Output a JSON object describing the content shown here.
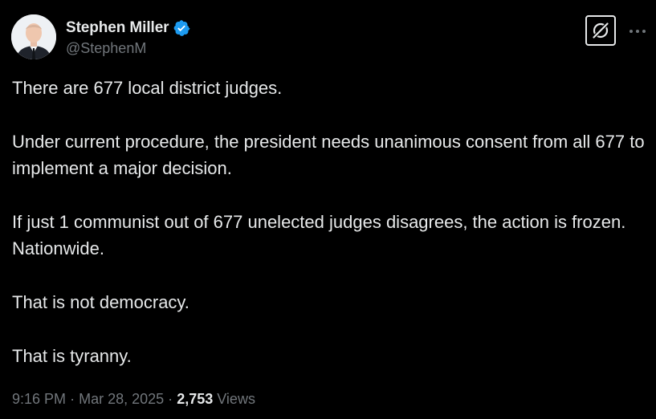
{
  "author": {
    "display_name": "Stephen Miller",
    "handle": "@StephenM",
    "verified": true,
    "verified_color": "#1d9bf0",
    "avatar_icon": "profile-photo"
  },
  "actions": {
    "grok_icon": "grok-icon",
    "more_icon": "more-icon"
  },
  "post": {
    "paragraphs": [
      "There are 677 local district judges.",
      "Under current procedure, the president needs unanimous consent from all 677 to implement a major decision.",
      "If just 1 communist out of 677 unelected judges disagrees, the action is frozen. Nationwide.",
      "That is not democracy.",
      "That is tyranny."
    ]
  },
  "meta": {
    "time": "9:16 PM",
    "separator": "·",
    "date": "Mar 28, 2025",
    "views_count": "2,753",
    "views_label": "Views"
  },
  "colors": {
    "background": "#000000",
    "text_primary": "#e7e9ea",
    "text_secondary": "#71767b"
  }
}
